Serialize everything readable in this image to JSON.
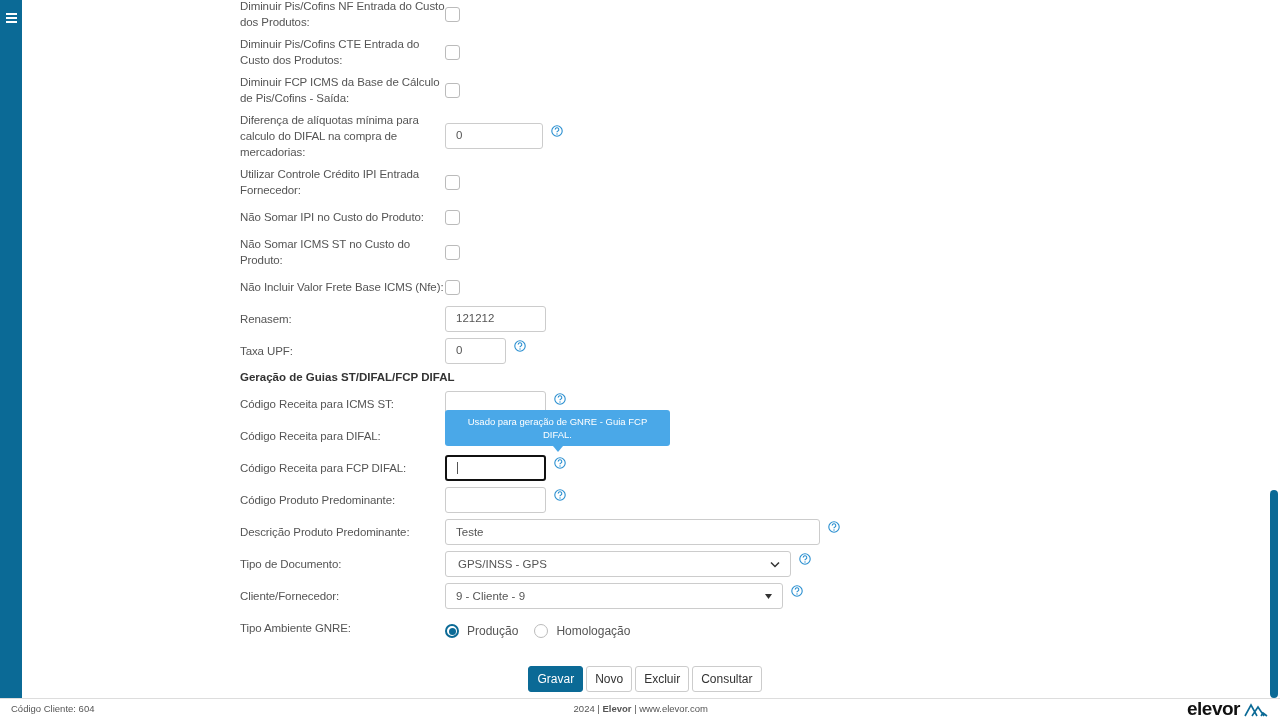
{
  "rows": [
    {
      "kind": "checkbox",
      "label": "Diminuir Pis/Cofins NF Entrada do Custo dos Produtos:",
      "checked": false
    },
    {
      "kind": "checkbox",
      "label": "Diminuir Pis/Cofins CTE Entrada do Custo dos Produtos:",
      "checked": false
    },
    {
      "kind": "checkbox",
      "label": "Diminuir FCP ICMS da Base de Cálculo de Pis/Cofins - Saída:",
      "checked": false
    },
    {
      "kind": "text",
      "label": "Diferença de alíquotas mínima para calculo do DIFAL na compra de mercadorias:",
      "value": "0",
      "help": true
    },
    {
      "kind": "checkbox",
      "label": "Utilizar Controle Crédito IPI Entrada Fornecedor:",
      "checked": false
    },
    {
      "kind": "checkbox",
      "label": "Não Somar IPI no Custo do Produto:",
      "checked": false
    },
    {
      "kind": "checkbox",
      "label": "Não Somar ICMS ST no Custo do Produto:",
      "checked": false
    },
    {
      "kind": "checkbox",
      "label": "Não Incluir Valor Frete Base ICMS (Nfe):",
      "checked": false
    },
    {
      "kind": "text",
      "label": "Renasem:",
      "value": "121212",
      "help": false
    },
    {
      "kind": "text",
      "label": "Taxa UPF:",
      "value": "0",
      "help": true
    },
    {
      "kind": "heading",
      "label": "Geração de Guias ST/DIFAL/FCP DIFAL"
    },
    {
      "kind": "text",
      "label": "Código Receita para ICMS ST:",
      "help": true
    },
    {
      "kind": "covered",
      "label": "Código Receita para DIFAL:"
    },
    {
      "kind": "text",
      "label": "Código Receita para FCP DIFAL:",
      "help": true,
      "focused": true,
      "tooltip": "Usado para geração de GNRE - Guia FCP DIFAL."
    },
    {
      "kind": "text",
      "label": "Código Produto Predominante:",
      "help": true
    },
    {
      "kind": "text",
      "label": "Descrição Produto Predominante:",
      "value": "Teste",
      "help": true
    },
    {
      "kind": "select",
      "label": "Tipo de Documento:",
      "value": "GPS/INSS - GPS",
      "help": true
    },
    {
      "kind": "combo",
      "label": "Cliente/Fornecedor:",
      "value": "9 - Cliente - 9",
      "help": true
    },
    {
      "kind": "radio",
      "label": "Tipo Ambiente GNRE:",
      "options": [
        {
          "label": "Produção",
          "selected": true
        },
        {
          "label": "Homologação",
          "selected": false
        }
      ]
    }
  ],
  "buttons": [
    {
      "label": "Gravar",
      "primary": true
    },
    {
      "label": "Novo",
      "primary": false
    },
    {
      "label": "Excluir",
      "primary": false
    },
    {
      "label": "Consultar",
      "primary": false
    }
  ],
  "footer": {
    "client": "Código Cliente: 604",
    "credits": "2024 | **Elevor** | www.elevor.com",
    "logo": "elevor"
  }
}
